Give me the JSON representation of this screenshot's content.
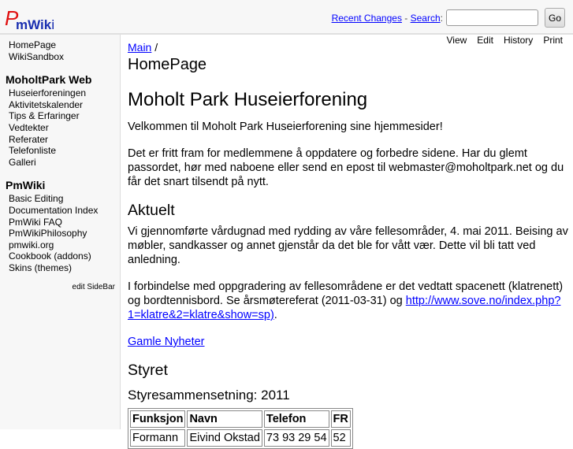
{
  "logo": {
    "text": "PmWiki"
  },
  "header": {
    "recent_changes": "Recent Changes",
    "sep": " - ",
    "search_link": "Search",
    "colon": ":",
    "search_placeholder": "",
    "go": "Go"
  },
  "sidebar": {
    "top": [
      "HomePage",
      "WikiSandbox"
    ],
    "sections": [
      {
        "title": "MoholtPark Web",
        "items": [
          "Huseierforeningen",
          "Aktivitetskalender",
          "Tips & Erfaringer",
          "Vedtekter",
          "Referater",
          "Telefonliste",
          "Galleri"
        ]
      },
      {
        "title": "PmWiki",
        "items": [
          "Basic Editing",
          "Documentation Index",
          "PmWiki FAQ",
          "PmWikiPhilosophy",
          "pmwiki.org",
          "Cookbook (addons)",
          "Skins (themes)"
        ]
      }
    ],
    "edit": "edit SideBar"
  },
  "actions": [
    "View",
    "Edit",
    "History",
    "Print"
  ],
  "main": {
    "crumb": "Main",
    "crumb_sep": " /",
    "title": "HomePage",
    "h1": "Moholt Park Huseierforening",
    "p1": "Velkommen til Moholt Park Huseierforening sine hjemmesider!",
    "p2": "Det er fritt fram for medlemmene å oppdatere og forbedre sidene. Har du glemt passordet, hør med naboene eller send en epost til webmaster@moholtpark.net og du får det snart tilsendt på nytt.",
    "h2a": "Aktuelt",
    "p3": "Vi gjennomførte vårdugnad med rydding av våre fellesområder, 4. mai 2011. Beising av møbler, sandkasser og annet gjenstår da det ble for vått vær. Dette vil bli tatt ved anledning.",
    "p4": "I forbindelse med oppgradering av fellesområdene er det vedtatt spacenett (klatrenett) og bordtennisbord. Se årsmøtereferat (2011-03-31) og ",
    "p4_link": "http://www.sove.no/index.php?1=klatre&2=klatre&show=sp)",
    "p4_end": ".",
    "old_news": "Gamle Nyheter",
    "h2b": "Styret",
    "h3": "Styresammensetning: 2011",
    "table": {
      "headers": [
        "Funksjon",
        "Navn",
        "Telefon",
        "FR"
      ],
      "rows": [
        [
          "Formann",
          "Eivind Okstad",
          "73 93 29 54",
          "52"
        ]
      ]
    }
  }
}
